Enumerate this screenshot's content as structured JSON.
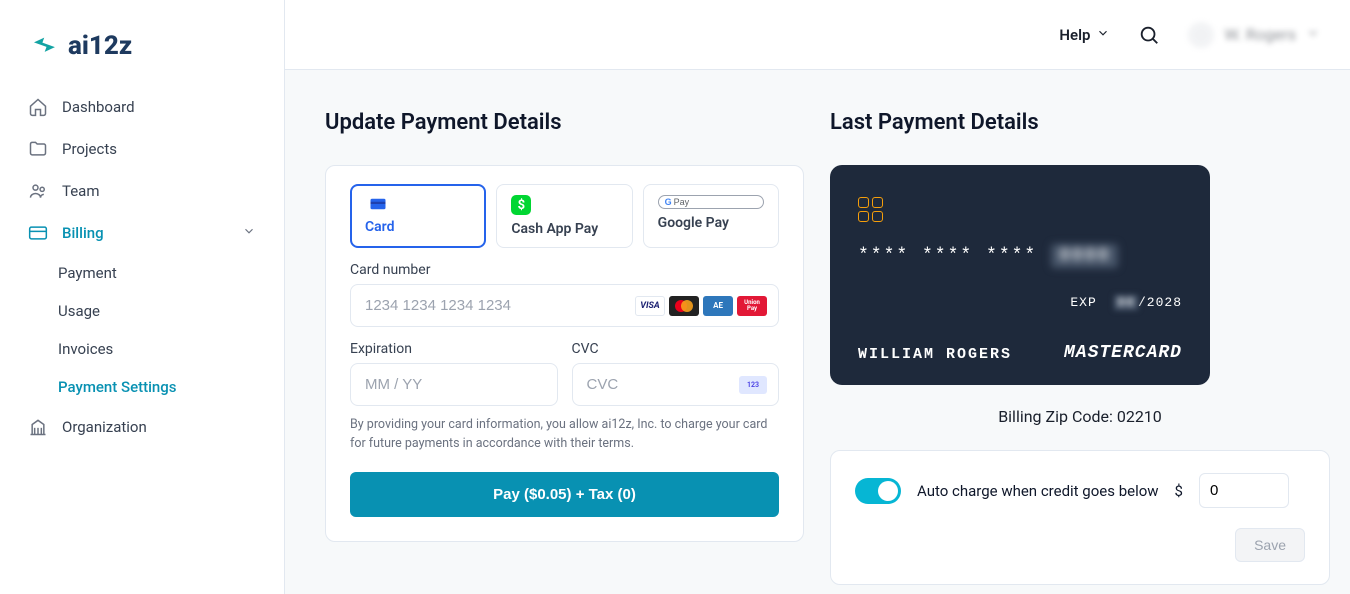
{
  "brand": "ai12z",
  "header": {
    "help": "Help",
    "user_name": "W. Rogers"
  },
  "sidebar": {
    "items": [
      {
        "label": "Dashboard",
        "icon": "home"
      },
      {
        "label": "Projects",
        "icon": "folder"
      },
      {
        "label": "Team",
        "icon": "team"
      },
      {
        "label": "Billing",
        "icon": "card",
        "active": true,
        "expanded": true
      },
      {
        "label": "Organization",
        "icon": "org"
      }
    ],
    "billing_sub": [
      {
        "label": "Payment"
      },
      {
        "label": "Usage"
      },
      {
        "label": "Invoices"
      },
      {
        "label": "Payment Settings",
        "active": true
      }
    ]
  },
  "update": {
    "title": "Update Payment Details",
    "methods": {
      "card": "Card",
      "cashapp": "Cash App Pay",
      "gpay": "Google Pay"
    },
    "card_number_label": "Card number",
    "card_number_placeholder": "1234 1234 1234 1234",
    "expiration_label": "Expiration",
    "expiration_placeholder": "MM / YY",
    "cvc_label": "CVC",
    "cvc_placeholder": "CVC",
    "cvc_badge": "123",
    "disclaimer": "By providing your card information, you allow ai12z, Inc. to charge your card for future payments in accordance with their terms.",
    "pay_button": "Pay ($0.05) + Tax (0)"
  },
  "last": {
    "title": "Last Payment Details",
    "card_mask": "**** **** ****",
    "card_last4": "0000",
    "exp_label": "EXP",
    "exp_month": "00",
    "exp_year": "/2028",
    "holder": "WILLIAM ROGERS",
    "brand": "MASTERCARD",
    "zip_label": "Billing Zip Code: ",
    "zip": "02210"
  },
  "auto": {
    "label": "Auto charge when credit goes below",
    "currency": "$",
    "threshold": "0",
    "save": "Save"
  }
}
